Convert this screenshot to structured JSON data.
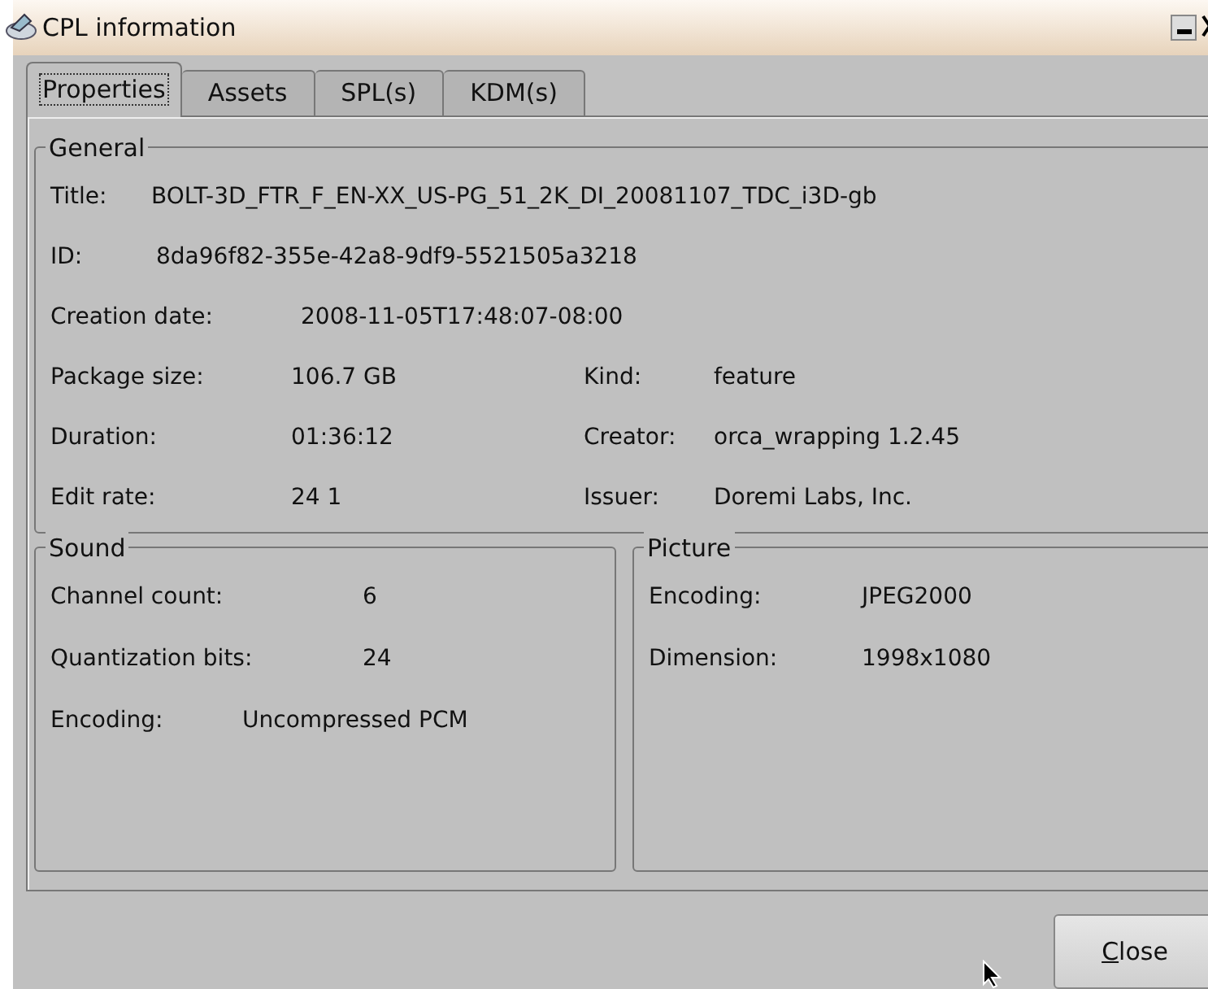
{
  "window": {
    "title": "CPL information"
  },
  "tabs": [
    {
      "label": "Properties",
      "selected": true
    },
    {
      "label": "Assets",
      "selected": false
    },
    {
      "label": "SPL(s)",
      "selected": false
    },
    {
      "label": "KDM(s)",
      "selected": false
    }
  ],
  "general": {
    "title": "General",
    "rows": [
      [
        {
          "label": "Title:",
          "value": "BOLT-3D_FTR_F_EN-XX_US-PG_51_2K_DI_20081107_TDC_i3D-gb"
        }
      ],
      [
        {
          "label": "ID:",
          "value": "8da96f82-355e-42a8-9df9-5521505a3218"
        }
      ],
      [
        {
          "label": "Creation date:",
          "value": "2008-11-05T17:48:07-08:00"
        }
      ],
      [
        {
          "label": "Package size:",
          "value": "106.7 GB"
        },
        {
          "label": "Kind:",
          "value": "feature"
        }
      ],
      [
        {
          "label": "Duration:",
          "value": "01:36:12"
        },
        {
          "label": "Creator:",
          "value": "orca_wrapping 1.2.45"
        }
      ],
      [
        {
          "label": "Edit rate:",
          "value": "24 1"
        },
        {
          "label": "Issuer:",
          "value": "Doremi Labs, Inc."
        }
      ]
    ]
  },
  "sound": {
    "title": "Sound",
    "fields": [
      {
        "label": "Channel count:",
        "value": "6"
      },
      {
        "label": "Quantization bits:",
        "value": "24"
      },
      {
        "label": "Encoding:",
        "value": "Uncompressed PCM"
      }
    ]
  },
  "picture": {
    "title": "Picture",
    "fields": [
      {
        "label": "Encoding:",
        "value": "JPEG2000"
      },
      {
        "label": "Dimension:",
        "value": "1998x1080"
      }
    ]
  },
  "buttons": [
    {
      "label": "Close"
    }
  ]
}
